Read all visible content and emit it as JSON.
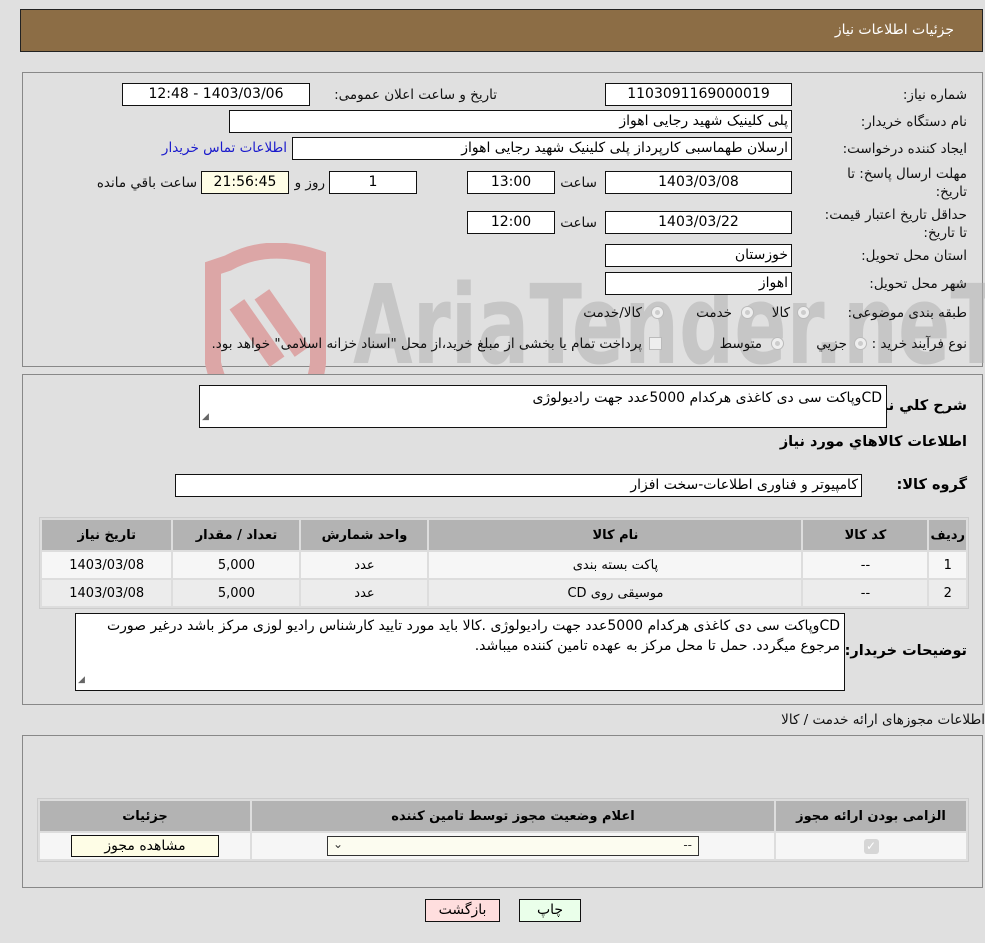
{
  "header": {
    "title": "جزئیات اطلاعات نیاز"
  },
  "details": {
    "need_number_label": "شماره نیاز:",
    "need_number": "1103091169000019",
    "announce_label": "تاریخ و ساعت اعلان عمومی:",
    "announce_value": "1403/03/06 - 12:48",
    "buyer_org_label": "نام دستگاه خریدار:",
    "buyer_org": "پلی کلینیک شهید رجایی اهواز",
    "creator_label": "ایجاد کننده درخواست:",
    "creator": "ارسلان طهماسبی کارپرداز پلی کلینیک شهید رجایی اهواز",
    "contact_link": "اطلاعات تماس خریدار",
    "deadline_label": "مهلت ارسال پاسخ: تا تاریخ:",
    "deadline_date": "1403/03/08",
    "time_label": "ساعت",
    "deadline_time": "13:00",
    "days_remaining": "1",
    "days_label": "روز و",
    "time_remaining": "21:56:45",
    "remaining_label": "ساعت باقي مانده",
    "validity_label": "حداقل تاریخ اعتبار قیمت: تا تاریخ:",
    "validity_date": "1403/03/22",
    "validity_time": "12:00",
    "province_label": "استان محل تحویل:",
    "province": "خوزستان",
    "city_label": "شهر محل تحویل:",
    "city": "اهواز",
    "category_label": "طبقه بندی موضوعی:",
    "category_options": [
      "کالا",
      "خدمت",
      "کالا/خدمت"
    ],
    "process_label": "نوع فرآیند خرید :",
    "process_options": [
      "جزیي",
      "متوسط"
    ],
    "process_note": "پرداخت تمام یا بخشی از مبلغ خرید،از محل \"اسناد خزانه اسلامی\" خواهد بود."
  },
  "goods": {
    "summary_label": "شرح کلي نياز:",
    "summary": "CDوپاکت سی دی کاغذی هرکدام 5000عدد جهت رادیولوژی",
    "section_title": "اطلاعات کالاهاي مورد نياز",
    "group_label": "گروه کالا:",
    "group": "کامپیوتر و فناوری اطلاعات-سخت افزار",
    "columns": [
      "ردیف",
      "کد کالا",
      "نام کالا",
      "واحد شمارش",
      "تعداد / مقدار",
      "تاریخ نیاز"
    ],
    "rows": [
      {
        "index": "1",
        "code": "--",
        "name": "پاکت بسته بندی",
        "unit": "عدد",
        "qty": "5,000",
        "date": "1403/03/08"
      },
      {
        "index": "2",
        "code": "--",
        "name": "موسیقی روی CD",
        "unit": "عدد",
        "qty": "5,000",
        "date": "1403/03/08"
      }
    ],
    "buyer_notes_label": "توضیحات خریدار:",
    "buyer_notes": "CDوپاکت سی دی کاغذی هرکدام 5000عدد جهت رادیولوژی .کالا باید مورد تایید کارشناس رادیو لوزی مرکز باشد درغیر صورت مرجوع میگردد. حمل تا محل مرکز به عهده تامین کننده میباشد."
  },
  "permits": {
    "section_title": "اطلاعات مجوزهای ارائه خدمت / کالا",
    "columns": [
      "الزامی بودن ارائه مجوز",
      "اعلام وضعیت مجوز توسط تامین کننده",
      "جزئیات"
    ],
    "row": {
      "required_checked": true,
      "status_selected": "--",
      "details_button": "مشاهده مجوز"
    }
  },
  "footer": {
    "print_button": "چاپ",
    "back_button": "بازگشت"
  },
  "watermark": {
    "text": "AriaTender.neT"
  },
  "colors": {
    "header_bg": "#8c6d45",
    "link": "#1a1acc",
    "print_bg": "#eaffea",
    "back_bg": "#ffdede",
    "highlight_bg": "#fefde6"
  }
}
